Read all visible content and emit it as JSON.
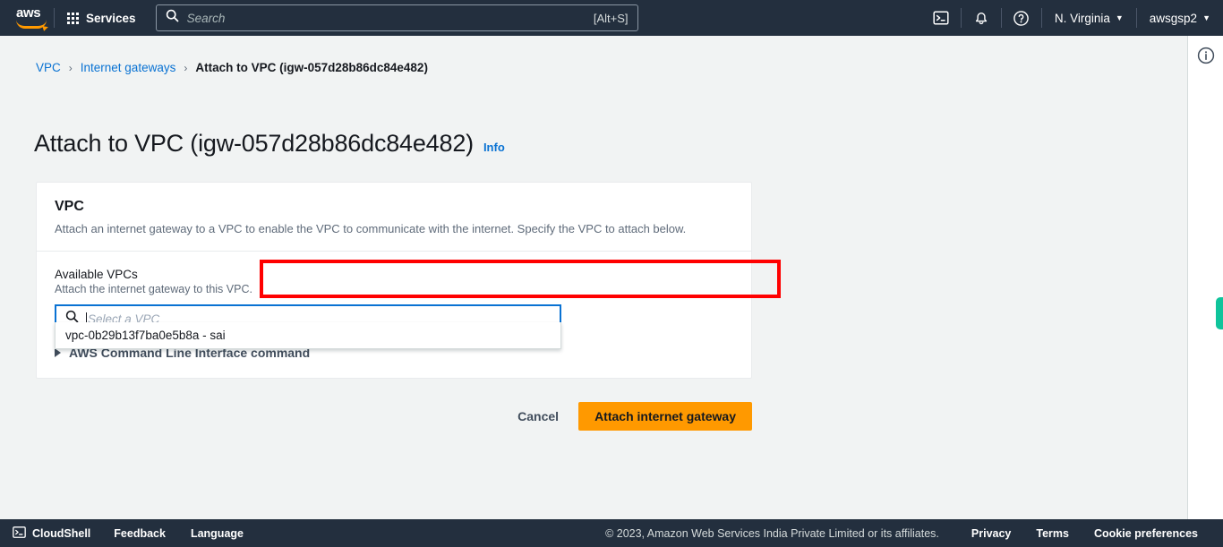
{
  "topnav": {
    "logo_text": "aws",
    "services_label": "Services",
    "search": {
      "placeholder": "Search",
      "shortcut_hint": "[Alt+S]",
      "icon": "search-icon"
    },
    "icons": [
      "cloudshell-icon",
      "bell-icon",
      "help-icon"
    ],
    "region_label": "N. Virginia",
    "account_label": "awsgsp2",
    "caret": "▼"
  },
  "breadcrumb": {
    "items": [
      {
        "label": "VPC",
        "current": false
      },
      {
        "label": "Internet gateways",
        "current": false
      },
      {
        "label": "Attach to VPC (igw-057d28b86dc84e482)",
        "current": true
      }
    ],
    "separator": "›"
  },
  "page": {
    "title": "Attach to VPC (igw-057d28b86dc84e482)",
    "info_label": "Info"
  },
  "card": {
    "title": "VPC",
    "description": "Attach an internet gateway to a VPC to enable the VPC to communicate with the internet. Specify the VPC to attach below.",
    "field": {
      "label": "Available VPCs",
      "hint": "Attach the internet gateway to this VPC.",
      "placeholder": "Select a VPC",
      "value": "",
      "search_icon": "search-icon"
    },
    "dropdown": {
      "options": [
        {
          "label": "vpc-0b29b13f7ba0e5b8a - sai"
        }
      ]
    },
    "cli_expander": {
      "label": "AWS Command Line Interface command",
      "expanded": false,
      "arrow_icon": "triangle-right-icon"
    }
  },
  "actions": {
    "cancel_label": "Cancel",
    "submit_label": "Attach internet gateway"
  },
  "right_rail": {
    "info_icon": "info-circle-icon",
    "help_tab": "green-help-tab"
  },
  "footer": {
    "cloudshell_label": "CloudShell",
    "cloudshell_icon": "terminal-icon",
    "links": [
      "Feedback",
      "Language"
    ],
    "copyright": "© 2023, Amazon Web Services India Private Limited or its affiliates.",
    "right_links": [
      "Privacy",
      "Terms",
      "Cookie preferences"
    ]
  },
  "colors": {
    "nav_background": "#232f3e",
    "page_background": "#f1f3f3",
    "accent_orange": "#ff9900",
    "link_blue": "#0972d3",
    "focus_blue": "#0972d3",
    "annotation_red": "#ff0000",
    "help_tab_green": "#0fc49b"
  }
}
